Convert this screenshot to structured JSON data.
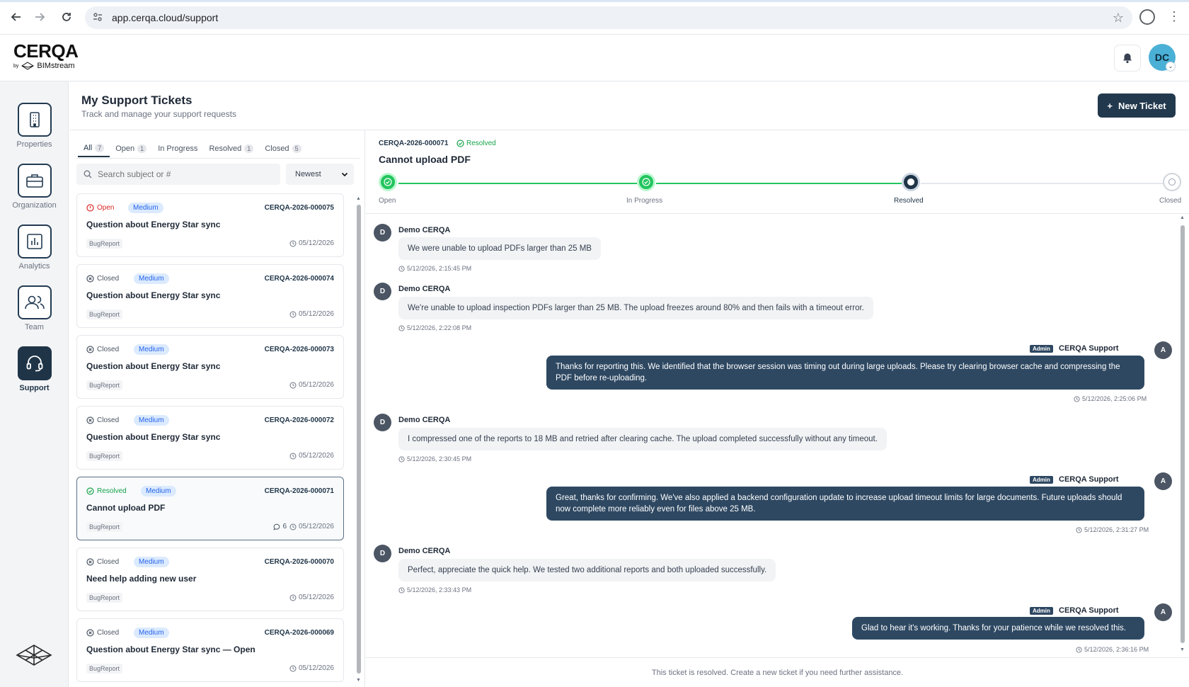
{
  "browser": {
    "url": "app.cerqa.cloud/support"
  },
  "header": {
    "logo_main": "CERQA",
    "logo_by": "by",
    "logo_brand": "BIMstream",
    "avatar_initials": "DC"
  },
  "sidebar": {
    "items": [
      {
        "label": "Properties",
        "icon": "building-icon"
      },
      {
        "label": "Organization",
        "icon": "briefcase-icon"
      },
      {
        "label": "Analytics",
        "icon": "bar-chart-icon"
      },
      {
        "label": "Team",
        "icon": "users-icon"
      },
      {
        "label": "Support",
        "icon": "headset-icon",
        "active": true
      }
    ]
  },
  "page": {
    "title": "My Support Tickets",
    "subtitle": "Track and manage your support requests",
    "new_ticket_label": "New Ticket"
  },
  "filters": {
    "tabs": [
      {
        "label": "All",
        "count": "7",
        "active": true
      },
      {
        "label": "Open",
        "count": "1"
      },
      {
        "label": "In Progress",
        "count": ""
      },
      {
        "label": "Resolved",
        "count": "1"
      },
      {
        "label": "Closed",
        "count": "5"
      }
    ],
    "search_placeholder": "Search subject or #",
    "sort_value": "Newest"
  },
  "tickets": [
    {
      "status": "Open",
      "priority": "Medium",
      "id": "CERQA-2026-000075",
      "title": "Question about Energy Star sync",
      "tag": "BugReport",
      "date": "05/12/2026",
      "comments": ""
    },
    {
      "status": "Closed",
      "priority": "Medium",
      "id": "CERQA-2026-000074",
      "title": "Question about Energy Star sync",
      "tag": "BugReport",
      "date": "05/12/2026",
      "comments": ""
    },
    {
      "status": "Closed",
      "priority": "Medium",
      "id": "CERQA-2026-000073",
      "title": "Question about Energy Star sync",
      "tag": "BugReport",
      "date": "05/12/2026",
      "comments": ""
    },
    {
      "status": "Closed",
      "priority": "Medium",
      "id": "CERQA-2026-000072",
      "title": "Question about Energy Star sync",
      "tag": "BugReport",
      "date": "05/12/2026",
      "comments": ""
    },
    {
      "status": "Resolved",
      "priority": "Medium",
      "id": "CERQA-2026-000071",
      "title": "Cannot upload PDF",
      "tag": "BugReport",
      "date": "05/12/2026",
      "comments": "6",
      "selected": true
    },
    {
      "status": "Closed",
      "priority": "Medium",
      "id": "CERQA-2026-000070",
      "title": "Need help adding new user",
      "tag": "BugReport",
      "date": "05/12/2026",
      "comments": ""
    },
    {
      "status": "Closed",
      "priority": "Medium",
      "id": "CERQA-2026-000069",
      "title": "Question about Energy Star sync — Open",
      "tag": "BugReport",
      "date": "05/12/2026",
      "comments": ""
    }
  ],
  "detail": {
    "id": "CERQA-2026-000071",
    "status": "Resolved",
    "title": "Cannot upload PDF",
    "steps": [
      {
        "label": "Open",
        "state": "done"
      },
      {
        "label": "In Progress",
        "state": "done"
      },
      {
        "label": "Resolved",
        "state": "current"
      },
      {
        "label": "Closed",
        "state": "future"
      }
    ],
    "messages": [
      {
        "side": "in",
        "initial": "D",
        "author": "Demo CERQA",
        "text": "We were unable to upload PDFs larger than 25 MB",
        "time": "5/12/2026, 2:15:45 PM"
      },
      {
        "side": "in",
        "initial": "D",
        "author": "Demo CERQA",
        "text": "We're unable to upload inspection PDFs larger than 25 MB. The upload freezes around 80% and then fails with a timeout error.",
        "time": "5/12/2026, 2:22:08 PM"
      },
      {
        "side": "out",
        "initial": "A",
        "badge": "Admin",
        "author": "CERQA Support",
        "text": "Thanks for reporting this. We identified that the browser session was timing out during large uploads. Please try clearing browser cache and compressing the PDF before re-uploading.",
        "time": "5/12/2026, 2:25:06 PM"
      },
      {
        "side": "in",
        "initial": "D",
        "author": "Demo CERQA",
        "text": "I compressed one of the reports to 18 MB and retried after clearing cache. The upload completed successfully without any timeout.",
        "time": "5/12/2026, 2:30:45 PM"
      },
      {
        "side": "out",
        "initial": "A",
        "badge": "Admin",
        "author": "CERQA Support",
        "text": "Great, thanks for confirming. We've also applied a backend configuration update to increase upload timeout limits for large documents. Future uploads should now complete more reliably even for files above 25 MB.",
        "time": "5/12/2026, 2:31:27 PM"
      },
      {
        "side": "in",
        "initial": "D",
        "author": "Demo CERQA",
        "text": "Perfect, appreciate the quick help. We tested two additional reports and both uploaded successfully.",
        "time": "5/12/2026, 2:33:43 PM"
      },
      {
        "side": "out",
        "initial": "A",
        "badge": "Admin",
        "author": "CERQA Support",
        "text": "Glad to hear it's working. Thanks for your patience while we resolved this.",
        "time": "5/12/2026, 2:36:16 PM"
      }
    ],
    "footer": "This ticket is resolved. Create a new ticket if you need further assistance."
  },
  "colors": {
    "primary": "#1f3447",
    "bubble_out": "#2e4862",
    "success": "#22c55e",
    "danger": "#dc2626",
    "priority": "#2563eb",
    "avatar": "#4bb0d6"
  }
}
